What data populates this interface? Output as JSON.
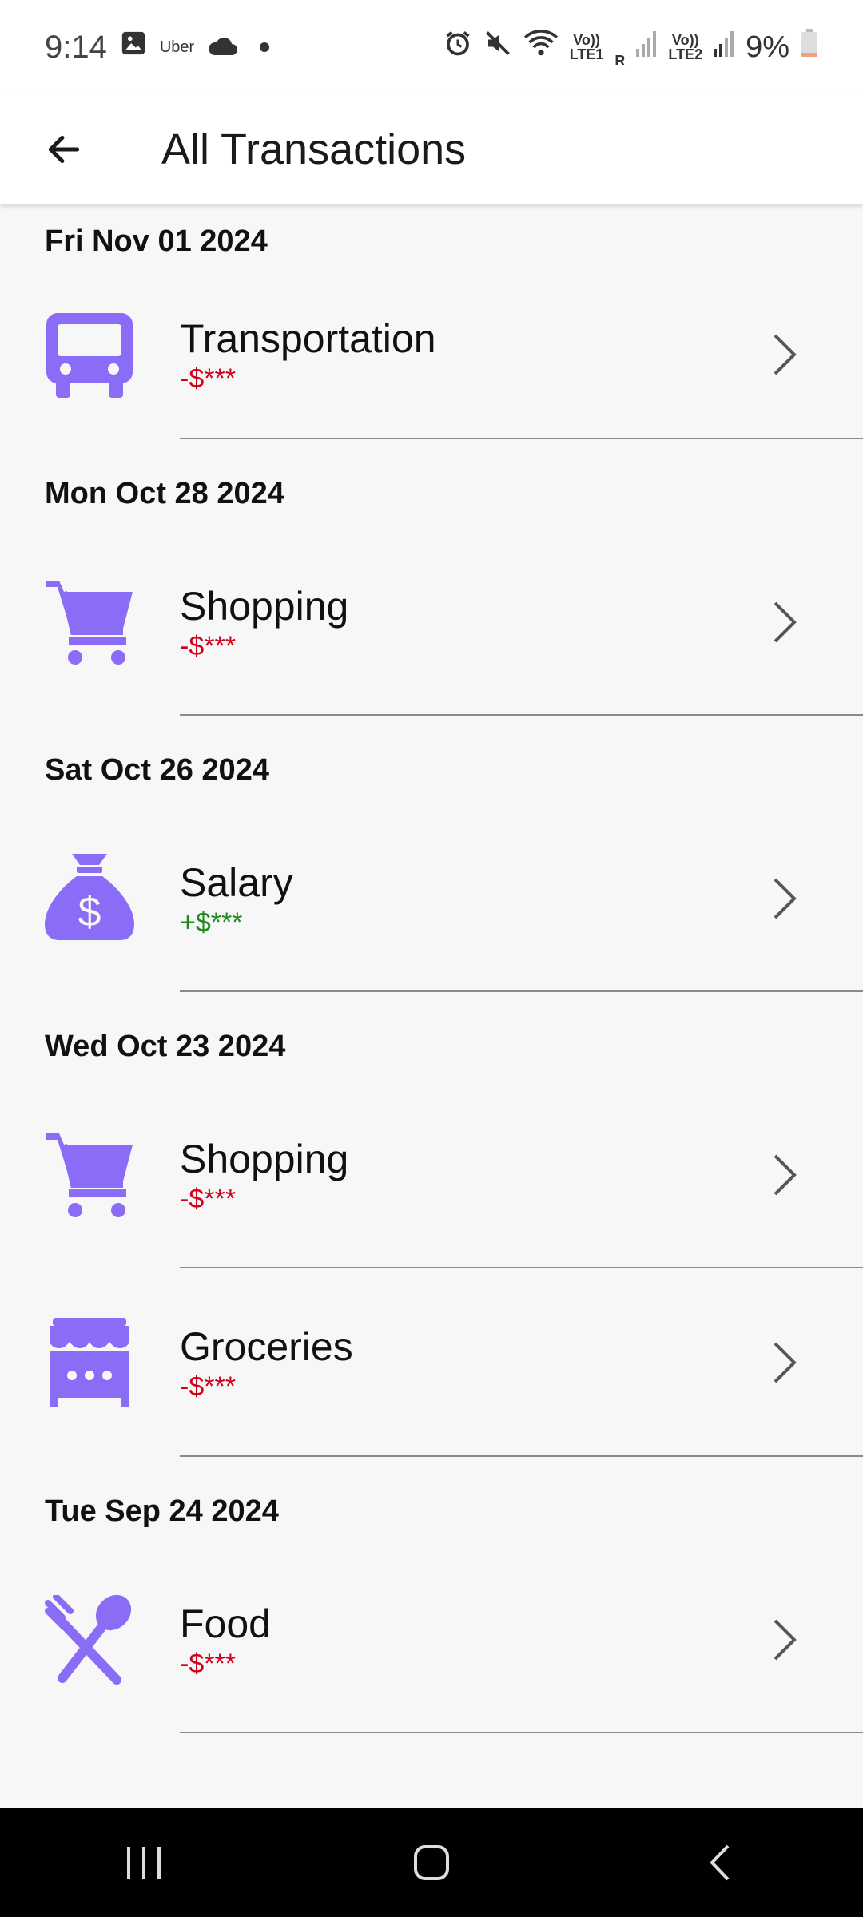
{
  "status_bar": {
    "time": "9:14",
    "carrier_app": "Uber",
    "lte1": "LTE1",
    "lte2": "LTE2",
    "volte": "Vo))",
    "roaming": "R",
    "battery": "9%"
  },
  "app_bar": {
    "title": "All Transactions"
  },
  "groups": [
    {
      "date": "Fri Nov 01 2024",
      "items": [
        {
          "category": "Transportation",
          "amount": "-$***",
          "icon": "bus-icon",
          "type": "expense"
        }
      ]
    },
    {
      "date": "Mon Oct 28 2024",
      "items": [
        {
          "category": "Shopping",
          "amount": "-$***",
          "icon": "cart-icon",
          "type": "expense"
        }
      ]
    },
    {
      "date": "Sat Oct 26 2024",
      "items": [
        {
          "category": "Salary",
          "amount": "+$***",
          "icon": "money-bag-icon",
          "type": "income"
        }
      ]
    },
    {
      "date": "Wed Oct 23 2024",
      "items": [
        {
          "category": "Shopping",
          "amount": "-$***",
          "icon": "cart-icon",
          "type": "expense"
        },
        {
          "category": "Groceries",
          "amount": "-$***",
          "icon": "store-icon",
          "type": "expense"
        }
      ]
    },
    {
      "date": "Tue Sep 24 2024",
      "items": [
        {
          "category": "Food",
          "amount": "-$***",
          "icon": "utensils-icon",
          "type": "expense"
        }
      ]
    }
  ],
  "colors": {
    "icon_purple": "#8b6cf6",
    "expense_red": "#d0021b",
    "income_green": "#1e8a1e"
  }
}
